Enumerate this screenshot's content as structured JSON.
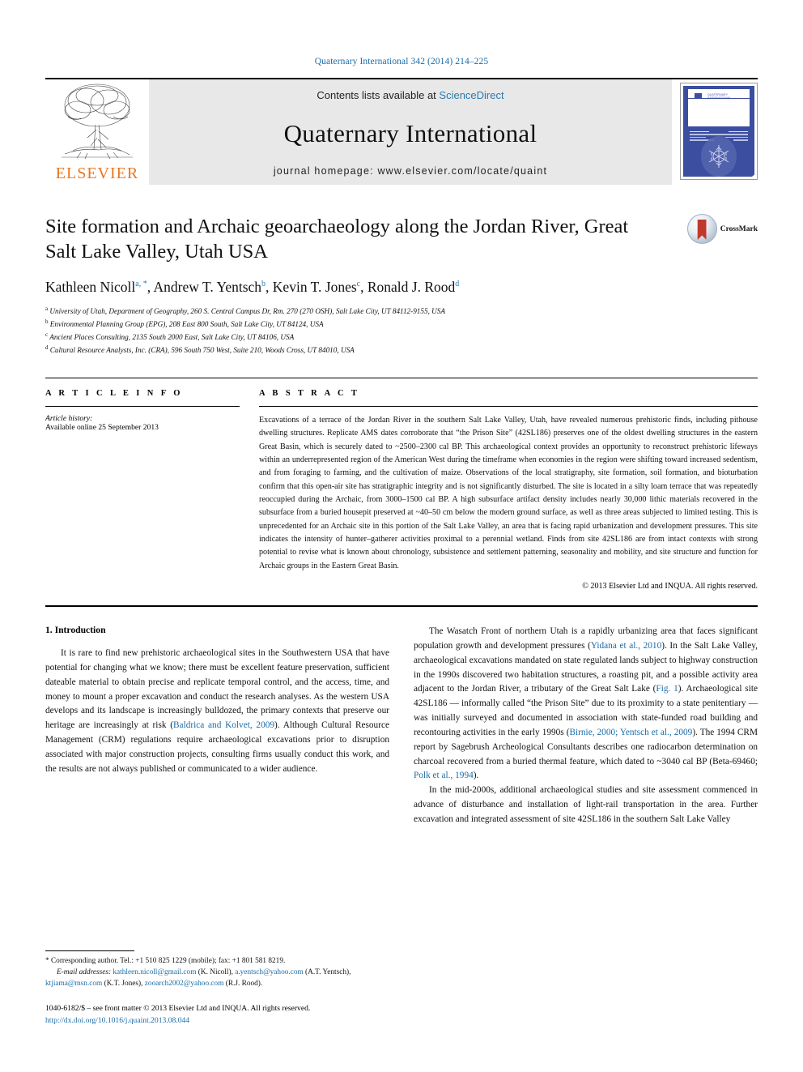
{
  "running_head": "Quaternary International 342 (2014) 214–225",
  "masthead": {
    "contents_prefix": "Contents lists available at ",
    "sciencedirect": "ScienceDirect",
    "journal_title": "Quaternary International",
    "homepage": "journal homepage: www.elsevier.com/locate/quaint",
    "publisher": "ELSEVIER",
    "cover_header": "QUATERNARY INTERNATIONAL"
  },
  "article": {
    "title": "Site formation and Archaic geoarchaeology along the Jordan River, Great Salt Lake Valley, Utah USA",
    "crossmark_label": "CrossMark",
    "authors": [
      {
        "name": "Kathleen Nicoll",
        "sup": "a, *"
      },
      {
        "name": "Andrew T. Yentsch",
        "sup": "b"
      },
      {
        "name": "Kevin T. Jones",
        "sup": "c"
      },
      {
        "name": "Ronald J. Rood",
        "sup": "d"
      }
    ],
    "affiliations": [
      {
        "label": "a",
        "text": "University of Utah, Department of Geography, 260 S. Central Campus Dr, Rm. 270 (270 OSH), Salt Lake City, UT 84112-9155, USA"
      },
      {
        "label": "b",
        "text": "Environmental Planning Group (EPG), 208 East 800 South, Salt Lake City, UT 84124, USA"
      },
      {
        "label": "c",
        "text": "Ancient Places Consulting, 2135 South 2000 East, Salt Lake City, UT 84106, USA"
      },
      {
        "label": "d",
        "text": "Cultural Resource Analysts, Inc. (CRA), 596 South 750 West, Suite 210, Woods Cross, UT 84010, USA"
      }
    ]
  },
  "article_info": {
    "heading": "A R T I C L E  I N F O",
    "history_label": "Article history:",
    "history_value": "Available online 25 September 2013"
  },
  "abstract": {
    "heading": "A B S T R A C T",
    "text": "Excavations of a terrace of the Jordan River in the southern Salt Lake Valley, Utah, have revealed numerous prehistoric finds, including pithouse dwelling structures. Replicate AMS dates corroborate that “the Prison Site” (42SL186) preserves one of the oldest dwelling structures in the eastern Great Basin, which is securely dated to ~2500–2300 cal BP. This archaeological context provides an opportunity to reconstruct prehistoric lifeways within an underrepresented region of the American West during the timeframe when economies in the region were shifting toward increased sedentism, and from foraging to farming, and the cultivation of maize. Observations of the local stratigraphy, site formation, soil formation, and bioturbation confirm that this open-air site has stratigraphic integrity and is not significantly disturbed. The site is located in a silty loam terrace that was repeatedly reoccupied during the Archaic, from 3000–1500 cal BP. A high subsurface artifact density includes nearly 30,000 lithic materials recovered in the subsurface from a buried housepit preserved at ~40–50 cm below the modern ground surface, as well as three areas subjected to limited testing. This is unprecedented for an Archaic site in this portion of the Salt Lake Valley, an area that is facing rapid urbanization and development pressures. This site indicates the intensity of hunter–gatherer activities proximal to a perennial wetland. Finds from site 42SL186 are from intact contexts with strong potential to revise what is known about chronology, subsistence and settlement patterning, seasonality and mobility, and site structure and function for Archaic groups in the Eastern Great Basin.",
    "copyright": "© 2013 Elsevier Ltd and INQUA. All rights reserved."
  },
  "body": {
    "section_heading": "1. Introduction",
    "left_paragraphs": [
      "It is rare to find new prehistoric archaeological sites in the Southwestern USA that have potential for changing what we know; there must be excellent feature preservation, sufficient dateable material to obtain precise and replicate temporal control, and the access, time, and money to mount a proper excavation and conduct the research analyses. As the western USA develops and its landscape is increasingly bulldozed, the primary contexts that preserve our heritage are increasingly at risk (REF:Baldrica and Kolvet, 2009). Although Cultural Resource Management (CRM) regulations require archaeological excavations prior to disruption associated with major construction projects, consulting firms usually conduct this work, and the results are not always published or communicated to a wider audience."
    ],
    "right_paragraphs": [
      "The Wasatch Front of northern Utah is a rapidly urbanizing area that faces significant population growth and development pressures (REF:Yidana et al., 2010). In the Salt Lake Valley, archaeological excavations mandated on state regulated lands subject to highway construction in the 1990s discovered two habitation structures, a roasting pit, and a possible activity area adjacent to the Jordan River, a tributary of the Great Salt Lake (REF:Fig. 1). Archaeological site 42SL186 — informally called “the Prison Site” due to its proximity to a state penitentiary — was initially surveyed and documented in association with state-funded road building and recontouring activities in the early 1990s (REF:Birnie, 2000; Yentsch et al., 2009). The 1994 CRM report by Sagebrush Archeological Consultants describes one radiocarbon determination on charcoal recovered from a buried thermal feature, which dated to ~3040 cal BP (Beta-69460; REF:Polk et al., 1994).",
      "In the mid-2000s, additional archaeological studies and site assessment commenced in advance of disturbance and installation of light-rail transportation in the area. Further excavation and integrated assessment of site 42SL186 in the southern Salt Lake Valley"
    ]
  },
  "footnote": {
    "corresponding": "* Corresponding author. Tel.: +1 510 825 1229 (mobile); fax: +1 801 581 8219.",
    "email_label": "E-mail addresses:",
    "emails": [
      {
        "address": "kathleen.nicoll@gmail.com",
        "owner": "(K. Nicoll)"
      },
      {
        "address": "a.yentsch@yahoo.com",
        "owner": "(A.T. Yentsch)"
      },
      {
        "address": "ktjiama@msn.com",
        "owner": "(K.T. Jones)"
      },
      {
        "address": "zooarch2002@yahoo.com",
        "owner": "(R.J. Rood)"
      }
    ],
    "issn_line": "1040-6182/$ – see front matter © 2013 Elsevier Ltd and INQUA. All rights reserved.",
    "doi": "http://dx.doi.org/10.1016/j.quaint.2013.08.044"
  },
  "colors": {
    "link": "#1b6ca8",
    "sciencedirect": "#2a7ab0",
    "elsevier_orange": "#e87722",
    "cover_blue": "#3b4ea0",
    "crossmark_red": "#c0392b"
  }
}
